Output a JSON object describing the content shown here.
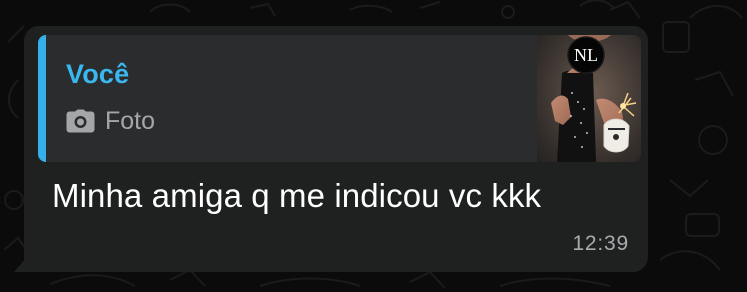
{
  "message": {
    "quote": {
      "author": "Você",
      "media_icon": "camera-icon",
      "media_label": "Foto",
      "thumbnail_monogram": "NL"
    },
    "text": "Minha amiga q me indicou vc kkk",
    "time": "12:39"
  },
  "colors": {
    "background": "#0b0b0b",
    "bubble": "#1f2121",
    "quote_background": "#2a2c2d",
    "quote_accent": "#35b0ea",
    "message_text": "#ffffff",
    "time_text": "#a8aaad"
  }
}
